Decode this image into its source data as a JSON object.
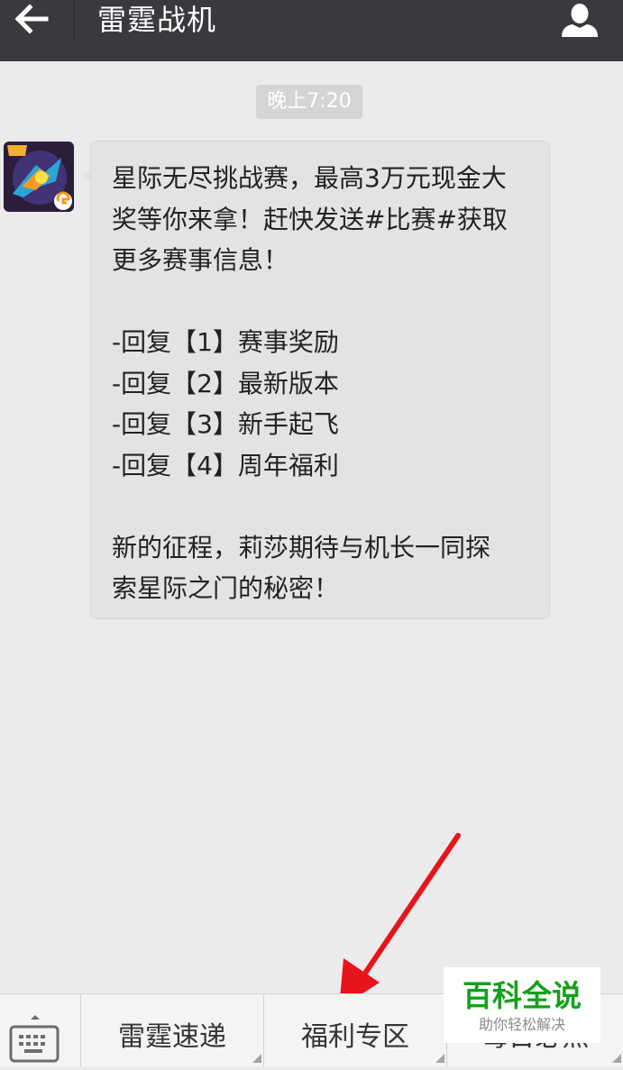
{
  "header": {
    "title": "雷霆战机",
    "back_icon": "arrow-left-icon",
    "profile_icon": "person-icon"
  },
  "chat": {
    "timestamp": "晚上7:20",
    "message": {
      "avatar_icon": "game-app-icon",
      "text": "星际无尽挑战赛，最高3万元现金大\n奖等你来拿！赶快发送#比赛#获取\n更多赛事信息！\n\n-回复【1】赛事奖励\n-回复【2】最新版本\n-回复【3】新手起飞\n-回复【4】周年福利\n\n新的征程，莉莎期待与机长一同探\n索星际之门的秘密！"
    }
  },
  "bottom_menu": {
    "keyboard_icon": "keyboard-icon",
    "items": [
      {
        "label": "雷霆速递"
      },
      {
        "label": "福利专区"
      },
      {
        "label": "每日必点"
      }
    ]
  },
  "watermark": {
    "main": "百科全说",
    "sub": "助你轻松解决"
  },
  "colors": {
    "titlebar": "#393a3e",
    "background": "#ebebeb",
    "bubble": "#e3e3e3",
    "annotation_arrow": "#e8141b",
    "watermark_green": "#13a11a"
  }
}
